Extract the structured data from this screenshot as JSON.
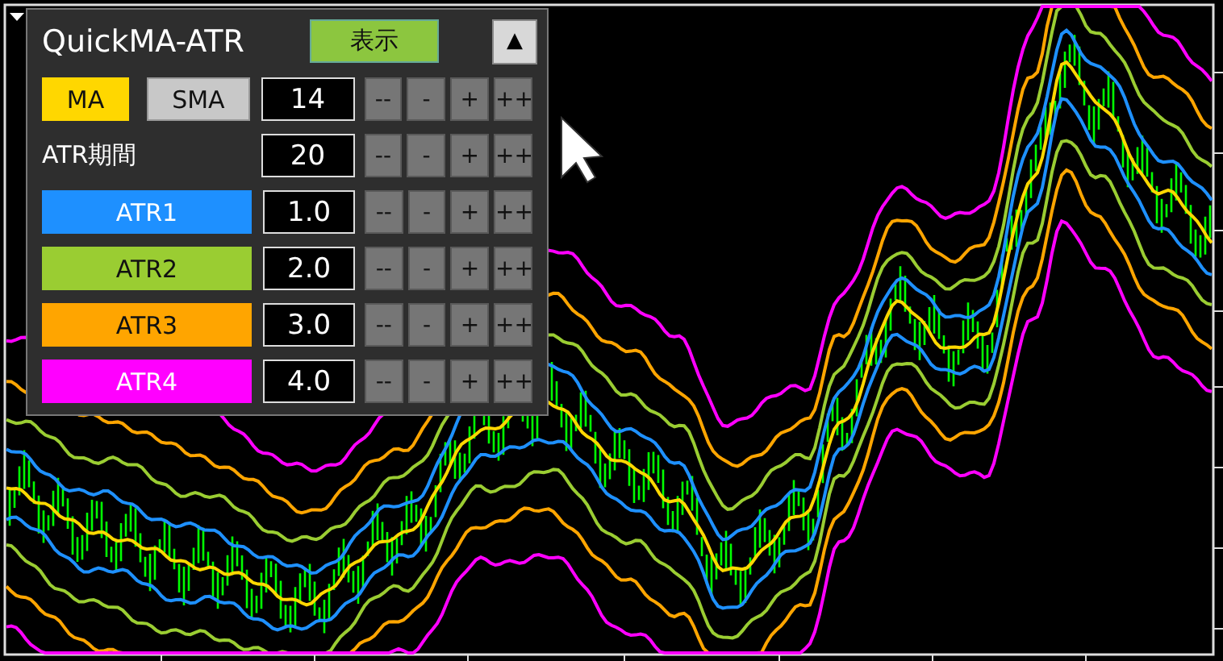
{
  "panel": {
    "title": "QuickMA-ATR",
    "show_button": "表示",
    "collapse_button": "▲",
    "ma_row": {
      "ma_button": "MA",
      "type_button": "SMA",
      "value": "14",
      "steps": [
        "--",
        "-",
        "+",
        "++"
      ]
    },
    "atr_row": {
      "label": "ATR期間",
      "value": "20",
      "steps": [
        "--",
        "-",
        "+",
        "++"
      ]
    },
    "bands": [
      {
        "label": "ATR1",
        "value": "1.0",
        "color": "#1e90ff",
        "steps": [
          "--",
          "-",
          "+",
          "++"
        ]
      },
      {
        "label": "ATR2",
        "value": "2.0",
        "color": "#9acd32",
        "steps": [
          "--",
          "-",
          "+",
          "++"
        ]
      },
      {
        "label": "ATR3",
        "value": "3.0",
        "color": "#ffa500",
        "steps": [
          "--",
          "-",
          "+",
          "++"
        ]
      },
      {
        "label": "ATR4",
        "value": "4.0",
        "color": "#ff00ff",
        "steps": [
          "--",
          "-",
          "+",
          "++"
        ]
      }
    ]
  }
}
